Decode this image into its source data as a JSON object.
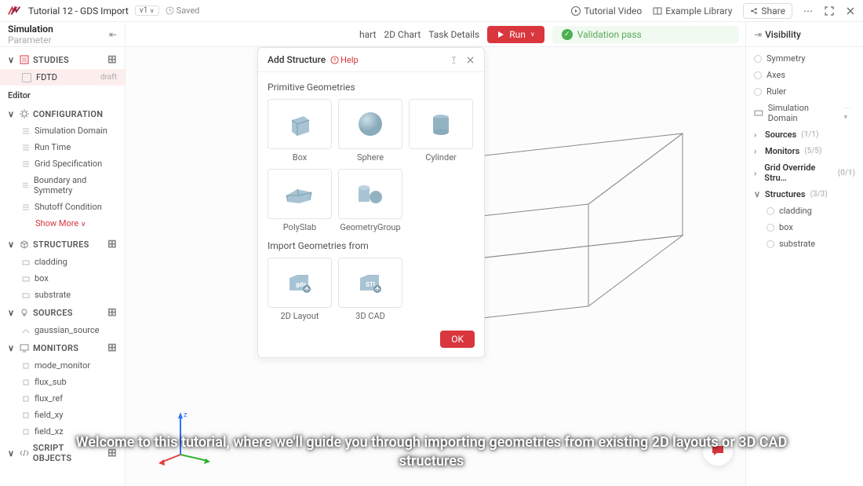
{
  "header": {
    "title": "Tutorial 12 - GDS Import",
    "version": "v1",
    "saved": "Saved",
    "tutorial_video": "Tutorial Video",
    "example_library": "Example Library",
    "share": "Share"
  },
  "left_panel": {
    "tabs": {
      "simulation": "Simulation",
      "parameter": "Parameter"
    },
    "studies": {
      "label": "STUDIES",
      "items": [
        {
          "label": "FDTD",
          "badge": "draft"
        }
      ]
    },
    "editor_label": "Editor",
    "configuration": {
      "label": "CONFIGURATION",
      "items": [
        "Simulation Domain",
        "Run Time",
        "Grid Specification",
        "Boundary and Symmetry",
        "Shutoff Condition"
      ],
      "show_more": "Show More"
    },
    "structures": {
      "label": "STRUCTURES",
      "items": [
        "cladding",
        "box",
        "substrate"
      ]
    },
    "sources": {
      "label": "SOURCES",
      "items": [
        "gaussian_source"
      ]
    },
    "monitors": {
      "label": "MONITORS",
      "items": [
        "mode_monitor",
        "flux_sub",
        "flux_ref",
        "field_xy",
        "field_xz"
      ]
    },
    "script_objects": {
      "label": "SCRIPT OBJECTS"
    }
  },
  "center": {
    "tabs": {
      "hart": "hart",
      "chart2d": "2D Chart",
      "task_details": "Task Details"
    },
    "run": "Run",
    "validation": "Validation pass"
  },
  "modal": {
    "title": "Add Structure",
    "help": "Help",
    "section_primitive": "Primitive Geometries",
    "primitives": [
      "Box",
      "Sphere",
      "Cylinder",
      "PolySlab",
      "GeometryGroup"
    ],
    "section_import": "Import Geometries from",
    "imports": [
      "2D Layout",
      "3D CAD"
    ],
    "import_badges": [
      "gds",
      "STL"
    ],
    "ok": "OK"
  },
  "right_panel": {
    "title": "Visibility",
    "items": {
      "symmetry": "Symmetry",
      "axes": "Axes",
      "ruler": "Ruler",
      "sim_domain": "Simulation Domain",
      "sources": "Sources",
      "sources_count": "(1/1)",
      "monitors": "Monitors",
      "monitors_count": "(5/5)",
      "grid_override": "Grid Override Stru…",
      "grid_count": "(0/1)",
      "structures": "Structures",
      "structures_count": "(3/3)",
      "cladding": "cladding",
      "box": "box",
      "substrate": "substrate"
    }
  },
  "subtitle": "Welcome to this tutorial, where we'll guide you through importing geometries from existing 2D layouts or 3D CAD structures"
}
